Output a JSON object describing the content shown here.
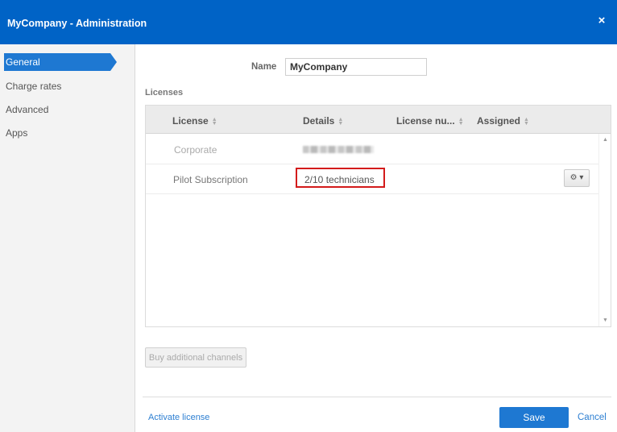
{
  "window": {
    "title": "MyCompany - Administration",
    "close_glyph": "×",
    "close_icon": "close-icon"
  },
  "sidebar": {
    "items": [
      {
        "label": "General",
        "active": true
      },
      {
        "label": "Charge rates",
        "active": false
      },
      {
        "label": "Advanced",
        "active": false
      },
      {
        "label": "Apps",
        "active": false
      }
    ]
  },
  "form": {
    "name_label": "Name",
    "name_value": "MyCompany"
  },
  "licenses": {
    "section_label": "Licenses",
    "columns": [
      "License",
      "Details",
      "License nu...",
      "Assigned"
    ],
    "rows": [
      {
        "license": "Corporate",
        "details": "",
        "details_redacted": true,
        "dimmed": true
      },
      {
        "license": "Pilot Subscription",
        "details": "2/10 technicians",
        "highlighted": true,
        "actions_icon": "gear-icon",
        "actions_caret": "▾"
      }
    ]
  },
  "buttons": {
    "buy_channels": "Buy additional channels",
    "activate_license": "Activate license",
    "save": "Save",
    "cancel": "Cancel"
  },
  "colors": {
    "title_bar": "#0063c6",
    "accent": "#1e78d2",
    "link": "#2d7fd2",
    "highlight_border": "#d31b1b"
  }
}
